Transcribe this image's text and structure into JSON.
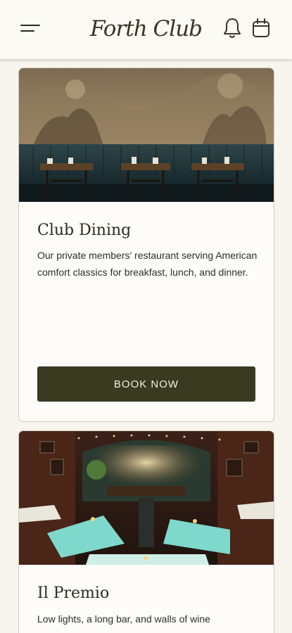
{
  "header": {
    "brand": "Forth Club",
    "icons": {
      "menu": "hamburger-menu-icon",
      "notifications": "bell-icon",
      "calendar": "calendar-icon"
    }
  },
  "cards": [
    {
      "title": "Club Dining",
      "description": "Our private members' restaurant serving American comfort classics for breakfast, lunch, and dinner.",
      "button_label": "BOOK NOW"
    },
    {
      "title": "Il Premio",
      "description": "Low lights, a long bar, and walls of wine"
    }
  ],
  "colors": {
    "accent": "#393a1f",
    "background": "#f7f5ee",
    "card": "#fdfcf8"
  }
}
